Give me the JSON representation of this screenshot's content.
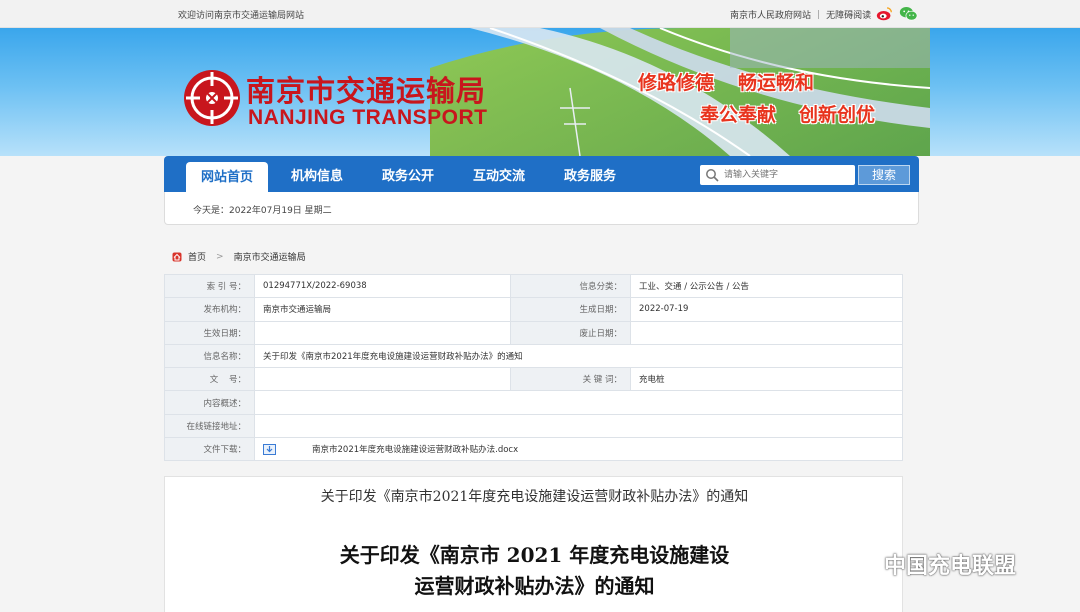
{
  "topbar": {
    "welcome": "欢迎访问南京市交通运输局网站",
    "gov_link": "南京市人民政府网站",
    "separator": "|",
    "accessible": "无障碍阅读"
  },
  "banner": {
    "title_cn": "南京市交通运输局",
    "title_en": "NANJING TRANSPORT",
    "slogans": [
      "修路修德",
      "畅运畅和",
      "奉公奉献",
      "创新创优"
    ]
  },
  "nav": {
    "items": [
      {
        "label": "网站首页",
        "active": true
      },
      {
        "label": "机构信息"
      },
      {
        "label": "政务公开"
      },
      {
        "label": "互动交流"
      },
      {
        "label": "政务服务"
      }
    ],
    "search_placeholder": "请输入关键字",
    "search_button": "搜索"
  },
  "datebar": {
    "text": "今天是：2022年07月19日  星期二"
  },
  "breadcrumb": {
    "home": "首页",
    "arrow": ">",
    "current": "南京市交通运输局"
  },
  "info": {
    "index_label": "索 引 号：",
    "index_value": "01294771X/2022-69038",
    "category_label": "信息分类：",
    "category_value": "工业、交通 / 公示公告 / 公告",
    "publisher_label": "发布机构：",
    "publisher_value": "南京市交通运输局",
    "created_label": "生成日期：",
    "created_value": "2022-07-19",
    "effective_label": "生效日期：",
    "effective_value": "",
    "expiry_label": "废止日期：",
    "expiry_value": "",
    "name_label": "信息名称：",
    "name_value": "关于印发《南京市2021年度充电设施建设运营财政补贴办法》的通知",
    "docno_label": "文    号：",
    "docno_value": "",
    "keyword_label": "关 键 词：",
    "keyword_value": "充电桩",
    "summary_label": "内容概述：",
    "summary_value": "",
    "link_label": "在线链接地址：",
    "link_value": "",
    "download_label": "文件下载：",
    "download_value": "南京市2021年度充电设施建设运营财政补贴办法.docx"
  },
  "article": {
    "subject": "关于印发《南京市2021年度充电设施建设运营财政补贴办法》的通知",
    "heading_line1": "关于印发《南京市 2021 年度充电设施建设",
    "heading_line2": "运营财政补贴办法》的通知"
  },
  "watermark": {
    "text": "中国充电联盟"
  },
  "colors": {
    "nav_blue": "#1f6fc6",
    "brand_red": "#c8161d",
    "slogan_red": "#e8341e"
  }
}
